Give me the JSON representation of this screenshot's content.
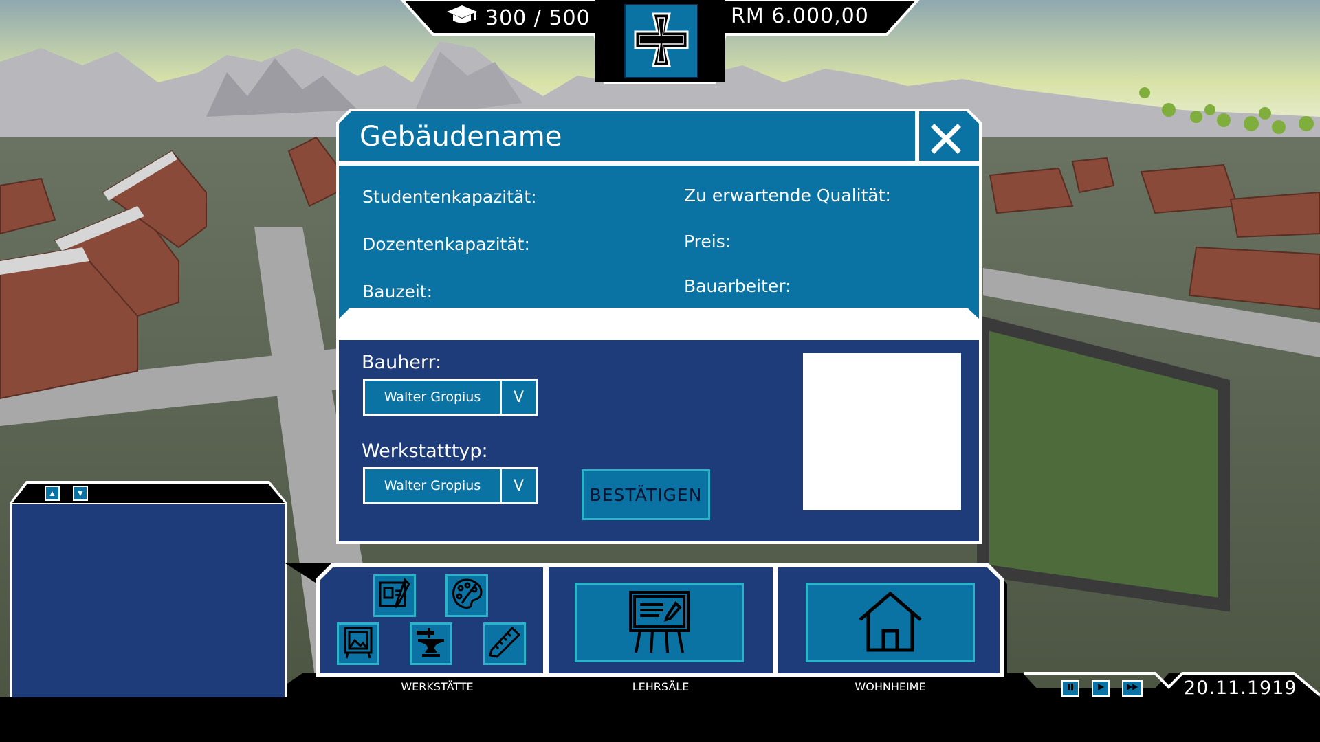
{
  "hud": {
    "students": "300 / 500",
    "money": "RM 6.000,00",
    "date": "20.11.1919"
  },
  "dialog": {
    "title": "Gebäudename",
    "info": {
      "student_capacity": "Studentenkapazität:",
      "lecturer_capacity": "Dozentenkapazität:",
      "build_time": "Bauzeit:",
      "expected_quality": "Zu erwartende Qualität:",
      "price": "Preis:",
      "construction_workers": "Bauarbeiter:"
    },
    "builder_label": "Bauherr:",
    "builder_value": "Walter Gropius",
    "workshop_type_label": "Werkstatttyp:",
    "workshop_type_value": "Walter Gropius",
    "dropdown_arrow": "V",
    "confirm_label": "BESTÄTIGEN"
  },
  "build_bar": {
    "categories": [
      "WERKSTÄTTE",
      "LEHRSÄLE",
      "WOHNHEIME"
    ]
  },
  "icons": {
    "students": "graduation-cap-icon",
    "emblem": "iron-cross-icon",
    "close": "close-icon",
    "workshops": [
      "blueprint-icon",
      "palette-icon",
      "picture-frame-icon",
      "anvil-icon",
      "saw-icon"
    ],
    "lecture_hall": "chalkboard-icon",
    "dorm": "house-icon",
    "time": [
      "pause-icon",
      "play-icon",
      "fast-forward-icon"
    ]
  },
  "colors": {
    "panel_teal": "#0a73a3",
    "panel_navy": "#1e3c7a",
    "accent_cyan": "#2bb4c9",
    "frame_white": "#ffffff",
    "hud_black": "#000000"
  }
}
